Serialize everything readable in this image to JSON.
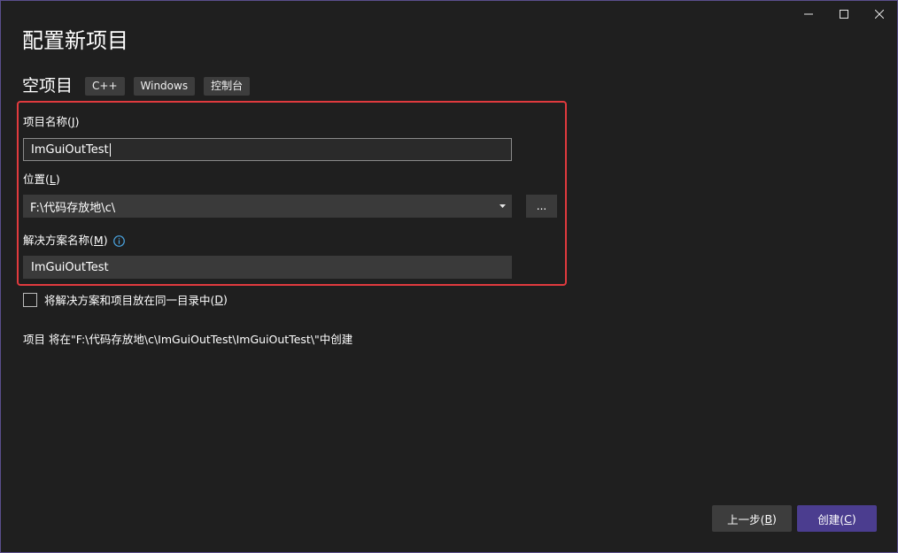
{
  "window": {
    "title": "配置新项目",
    "controls": [
      "minimize-icon",
      "maximize-icon",
      "close-icon"
    ]
  },
  "template": {
    "name": "空项目",
    "tags": [
      "C++",
      "Windows",
      "控制台"
    ]
  },
  "form": {
    "project_name": {
      "label": "项目名称(",
      "accel": "J",
      "label_end": ")",
      "value": "ImGuiOutTest"
    },
    "location": {
      "label": "位置(",
      "accel": "L",
      "label_end": ")",
      "value": "F:\\代码存放地\\c\\",
      "browse_label": "..."
    },
    "solution_name": {
      "label": "解决方案名称(",
      "accel": "M",
      "label_end": ")",
      "value": "ImGuiOutTest"
    },
    "same_dir": {
      "label": "将解决方案和项目放在同一目录中(",
      "accel": "D",
      "label_end": ")",
      "checked": false
    }
  },
  "info": "项目 将在\"F:\\代码存放地\\c\\ImGuiOutTest\\ImGuiOutTest\\\"中创建",
  "buttons": {
    "back": {
      "label": "上一步(",
      "accel": "B",
      "label_end": ")"
    },
    "create": {
      "label": "创建(",
      "accel": "C",
      "label_end": ")"
    }
  },
  "colors": {
    "background": "#1f1f1f",
    "highlight": "#e03a3e",
    "primary_button": "#4b3d8f",
    "info_icon": "#4aa3df"
  }
}
